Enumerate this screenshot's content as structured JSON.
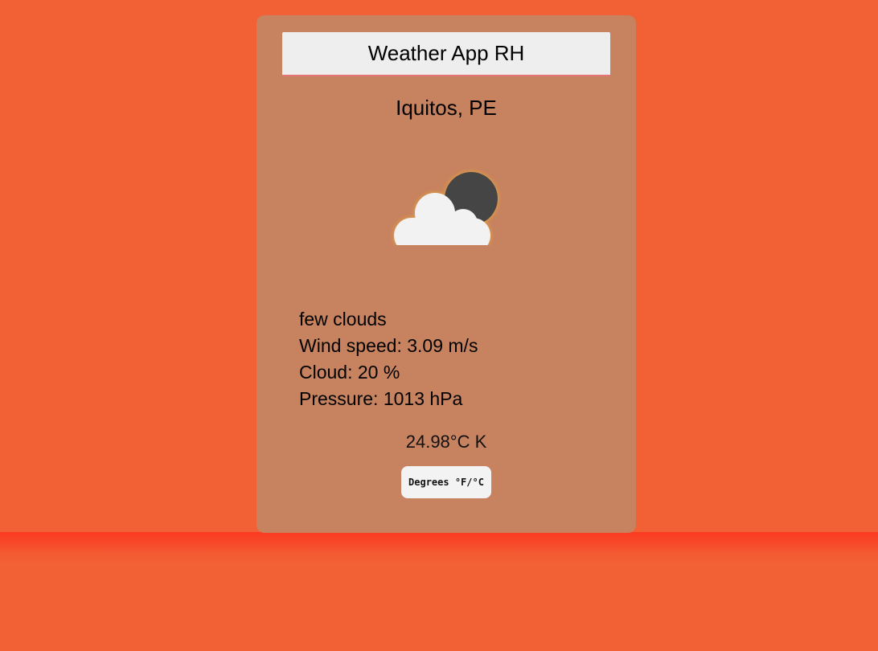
{
  "app": {
    "title": "Weather App RH"
  },
  "location": {
    "city": "Iquitos, PE"
  },
  "weather": {
    "icon": "few-clouds-night-icon",
    "description": "few clouds",
    "wind": "Wind speed: 3.09 m/s",
    "cloud": "Cloud: 20 %",
    "pressure": "Pressure: 1013 hPa",
    "temperature": "24.98°C K"
  },
  "controls": {
    "unit_toggle_label": "Degrees °F/°C"
  },
  "colors": {
    "background": "#f26135",
    "card": "#c7825f",
    "title_bar": "#eeeeee",
    "moon": "#454545",
    "cloud": "#f2f2f2"
  }
}
